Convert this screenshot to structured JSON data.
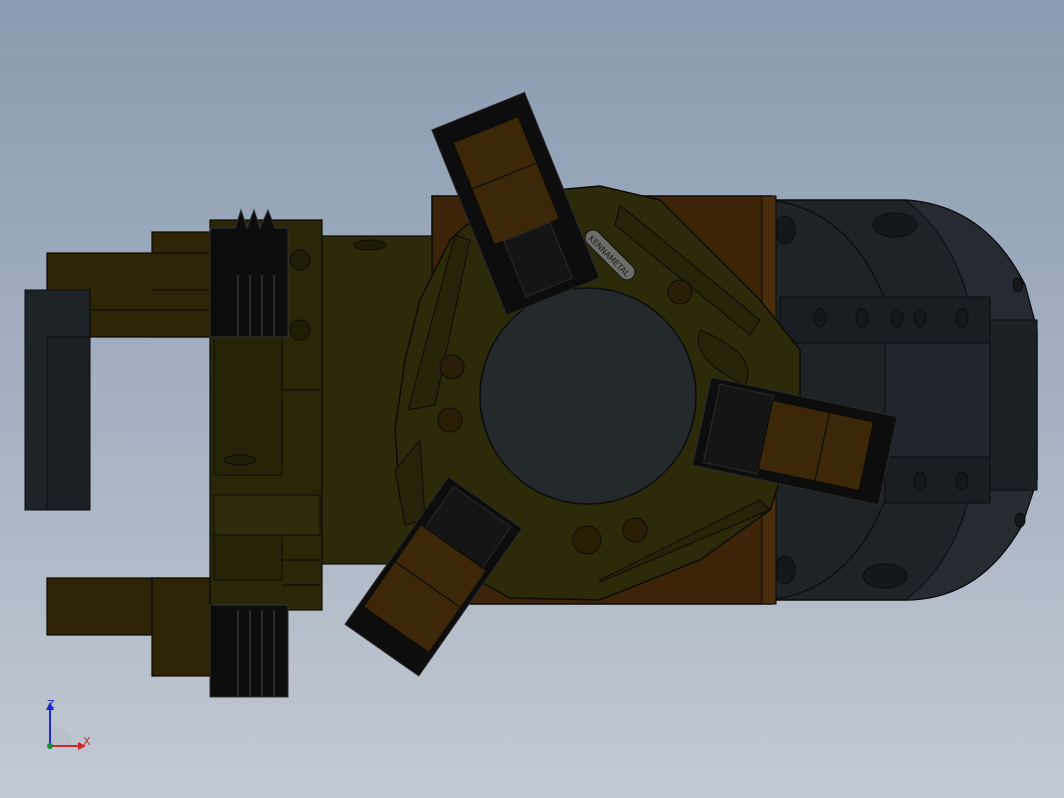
{
  "viewport": {
    "background_top": "#8a9bb1",
    "background_bottom": "#c3c9d3"
  },
  "model": {
    "colors": {
      "gold": "#2f2405",
      "gold_dark": "#231b04",
      "brass": "#3c2808",
      "brass_light": "#4a3210",
      "olive": "#2d2a0a",
      "olive_dark": "#1f1d06",
      "black": "#0d0d0d",
      "charcoal": "#1e2328",
      "slate": "#252b30",
      "orange_panel": "#3d2408",
      "bore": "#24292b"
    },
    "engraving": "KENNAMETAL"
  },
  "triad": {
    "z_label": "Z",
    "x_label": "X",
    "z_color": "#1a2bd0",
    "x_color": "#d0282a",
    "origin_color": "#1a8c3a"
  }
}
